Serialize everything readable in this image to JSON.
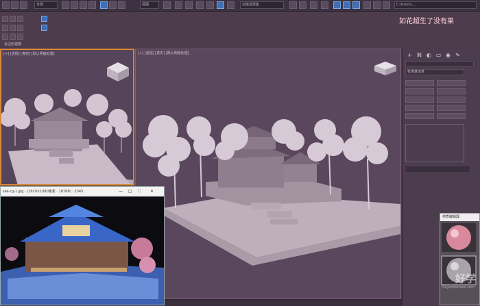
{
  "toolbar": {
    "selection_filter": "全部",
    "view_dropdown": "视图",
    "named_selection": "创建选择集",
    "workspace": "默认",
    "path_text": "C:\\Users\\..."
  },
  "overlay_caption": "如花超生了没有果",
  "ribbon": {
    "group_label": "多边形建模"
  },
  "viewports": {
    "left_label": "[+] [透视] [真实] [默认明暗处理]",
    "main_label": "[+] [透视] [真实] [默认明暗处理]"
  },
  "command_panel": {
    "object_type_dropdown": "标准基本体",
    "icons": [
      "+",
      "⌘",
      "◐",
      "▭",
      "◉",
      "✎",
      "🔧"
    ]
  },
  "image_viewer": {
    "title": "ske-cg-1.jpg · (1920×1080像素 · 187KB) · 2345...",
    "controls": [
      "—",
      "□",
      "⛶",
      "✕"
    ]
  },
  "material_editor": {
    "title": "材质编辑器"
  },
  "watermark": {
    "main": "好学",
    "sub": "91goodschool.com"
  },
  "colors": {
    "accent_orange": "#d98a3a",
    "toolbar_blue": "#3e6fb8",
    "caption_pink": "#ffd2df"
  }
}
